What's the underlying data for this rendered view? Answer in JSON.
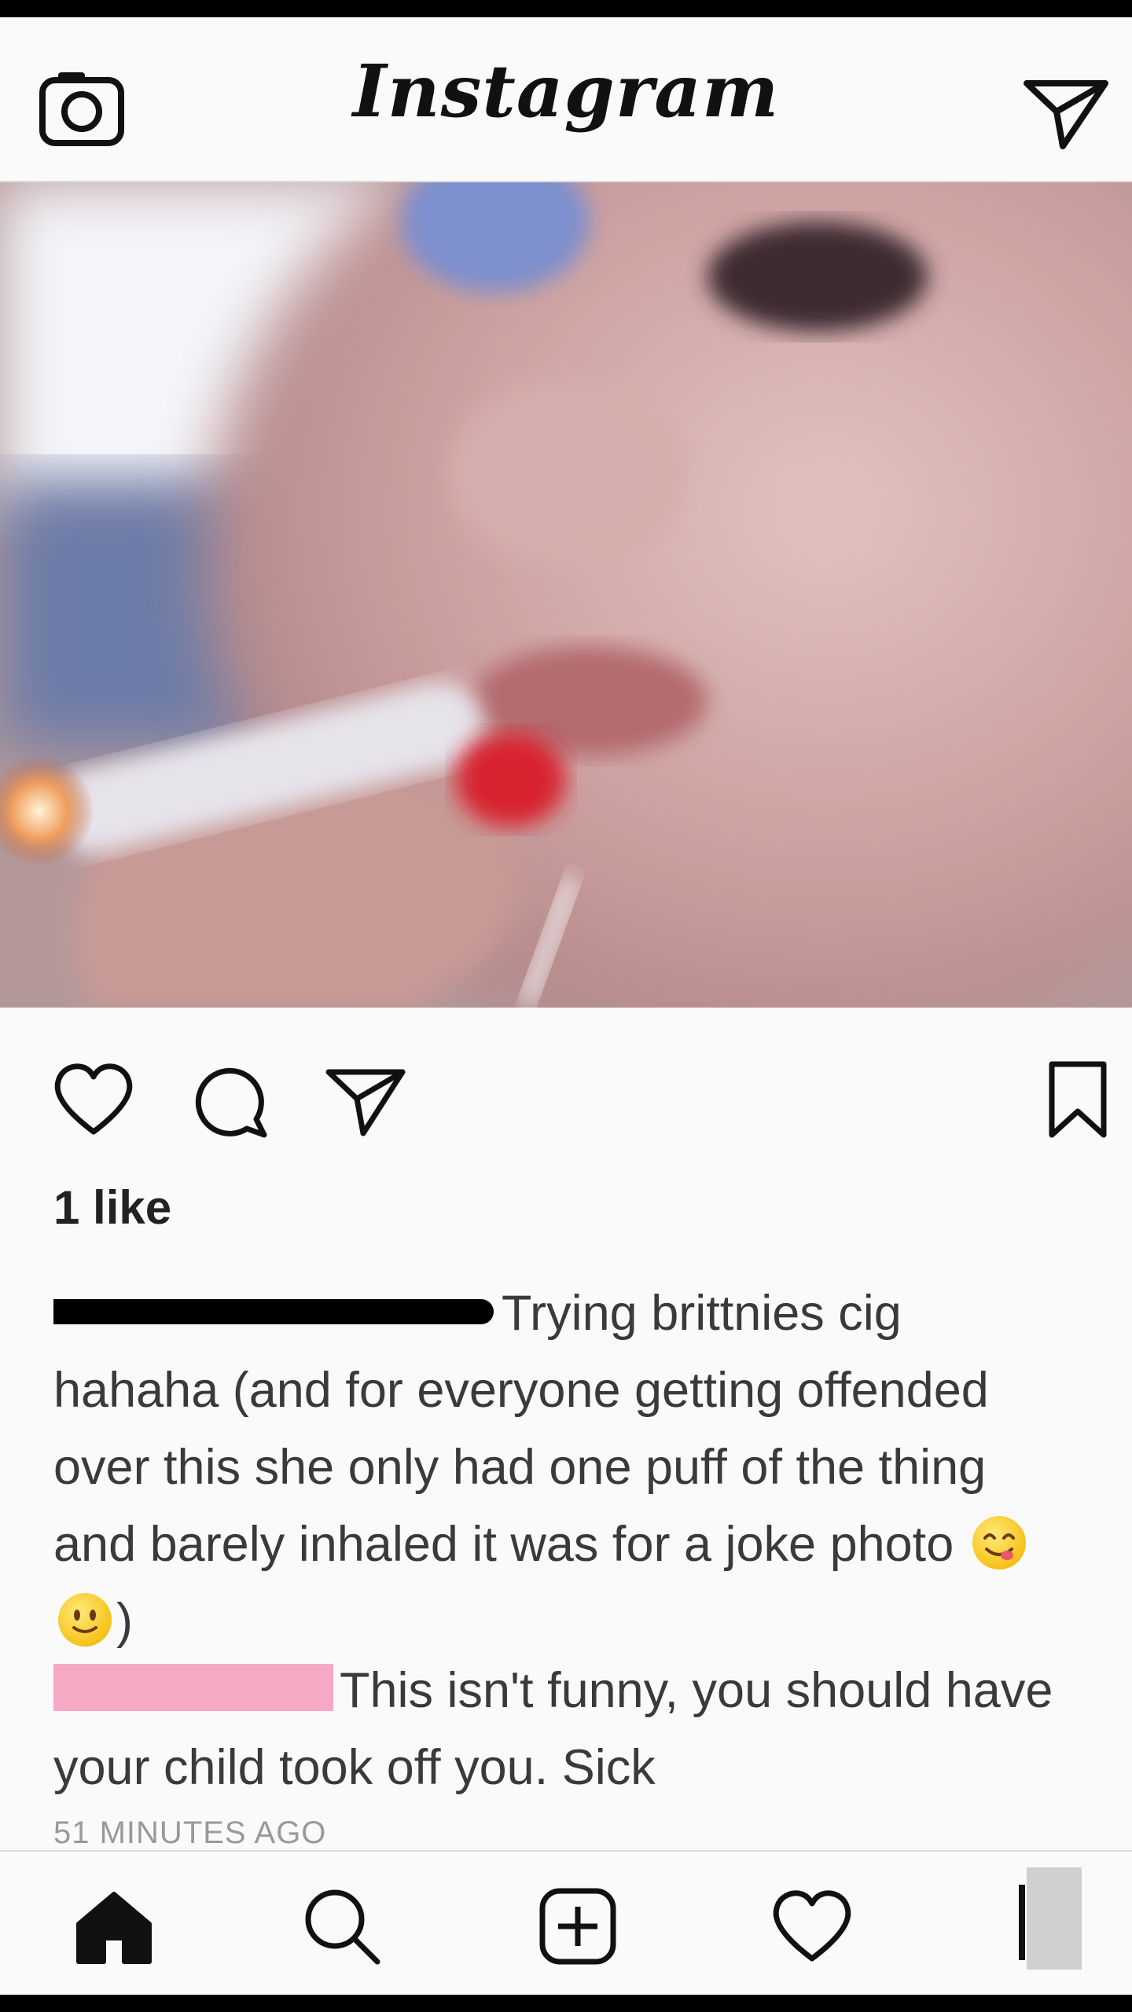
{
  "header": {
    "logo_text": "Instagram",
    "camera_icon": "camera-icon",
    "direct_icon": "paper-plane-icon"
  },
  "post": {
    "image_alt_semantic": "post-photo",
    "likes": "1 like",
    "caption_text": "Trying brittnies cig hahaha (and for everyone getting offended over this she only had one puff of the thing and barely inhaled it was for a joke photo",
    "caption_close": ")",
    "comment_text": "This isn't funny, you should have your child took off you. Sick",
    "timestamp": "51 MINUTES AGO"
  },
  "actions": {
    "like_icon": "heart-icon",
    "comment_icon": "comment-icon",
    "share_icon": "paper-plane-icon",
    "save_icon": "bookmark-icon"
  },
  "nav": {
    "items": [
      "home-icon",
      "search-icon",
      "add-icon",
      "heart-icon",
      "profile-icon"
    ]
  },
  "colors": {
    "background": "#fafafa",
    "text": "#262626",
    "muted": "#999999",
    "divider": "#dbdbdb",
    "redaction_pink": "#f5a9c4"
  }
}
